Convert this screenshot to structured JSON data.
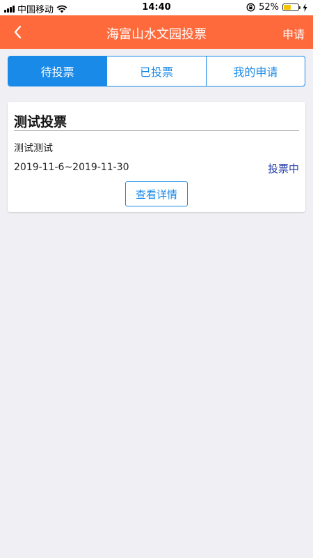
{
  "status_bar": {
    "carrier": "中国移动",
    "time": "14:40",
    "battery_percent": "52%",
    "battery_level": 0.52
  },
  "nav": {
    "title": "海富山水文园投票",
    "action_label": "申请",
    "back_icon": "chevron-left-icon",
    "bg_color": "#ff6a3c"
  },
  "tabs": [
    {
      "label": "待投票",
      "active": true
    },
    {
      "label": "已投票",
      "active": false
    },
    {
      "label": "我的申请",
      "active": false
    }
  ],
  "accent_color": "#1a8ae8",
  "votes": [
    {
      "title": "测试投票",
      "description": "测试测试",
      "date_range": "2019-11-6~2019-11-30",
      "status": "投票中",
      "detail_label": "查看详情"
    }
  ]
}
